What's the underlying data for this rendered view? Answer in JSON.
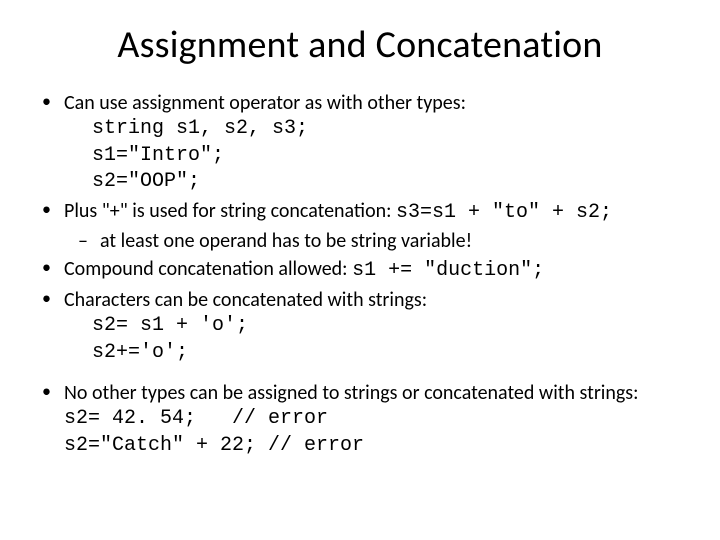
{
  "title": "Assignment and Concatenation",
  "b1": {
    "text": "Can use assignment operator as with other types:",
    "code1": "string s1, s2, s3;",
    "code2": "s1=\"Intro\";",
    "code3": "s2=\"OOP\";"
  },
  "b2": {
    "text_a": "Plus \"+\" is used for string concatenation:   ",
    "code": "s3=s1 + \"to\" + s2;",
    "sub1": "at least one operand has to be string variable!"
  },
  "b3": {
    "text_a": "Compound concatenation allowed:      ",
    "code": "s1 += \"duction\";"
  },
  "b4": {
    "text": "Characters can be concatenated with strings:",
    "code1": "s2= s1 + 'o';",
    "code2": "s2+='o';"
  },
  "b5": {
    "text": "No other types can be assigned to strings or concatenated with strings:",
    "code1": "s2= 42. 54;   // error",
    "code2": "s2=\"Catch\" + 22; // error"
  }
}
